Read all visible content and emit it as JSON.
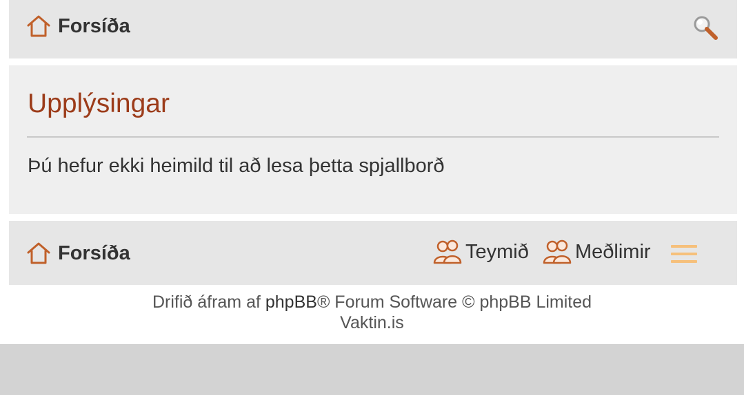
{
  "nav": {
    "home_label": "Forsíða",
    "search_icon": "search-icon",
    "home_icon": "home-icon"
  },
  "panel": {
    "title": "Upplýsingar",
    "message": "Þú hefur ekki heimild til að lesa þetta spjallborð"
  },
  "bottom_nav": {
    "home_label": "Forsíða",
    "team_label": "Teymið",
    "members_label": "Meðlimir",
    "team_icon": "team-icon",
    "members_icon": "members-icon",
    "menu_icon": "hamburger-menu-icon"
  },
  "footer": {
    "powered_prefix": "Drifið áfram af ",
    "phpbb_link": "phpBB",
    "powered_suffix": "® Forum Software © phpBB Limited",
    "site_name": "Vaktin.is"
  },
  "colors": {
    "title": "#9c3c1a",
    "icon_accent": "#c0602a",
    "menu_accent": "#f6c07b",
    "navbar_bg": "#e6e6e6",
    "panel_bg": "#efefef"
  }
}
